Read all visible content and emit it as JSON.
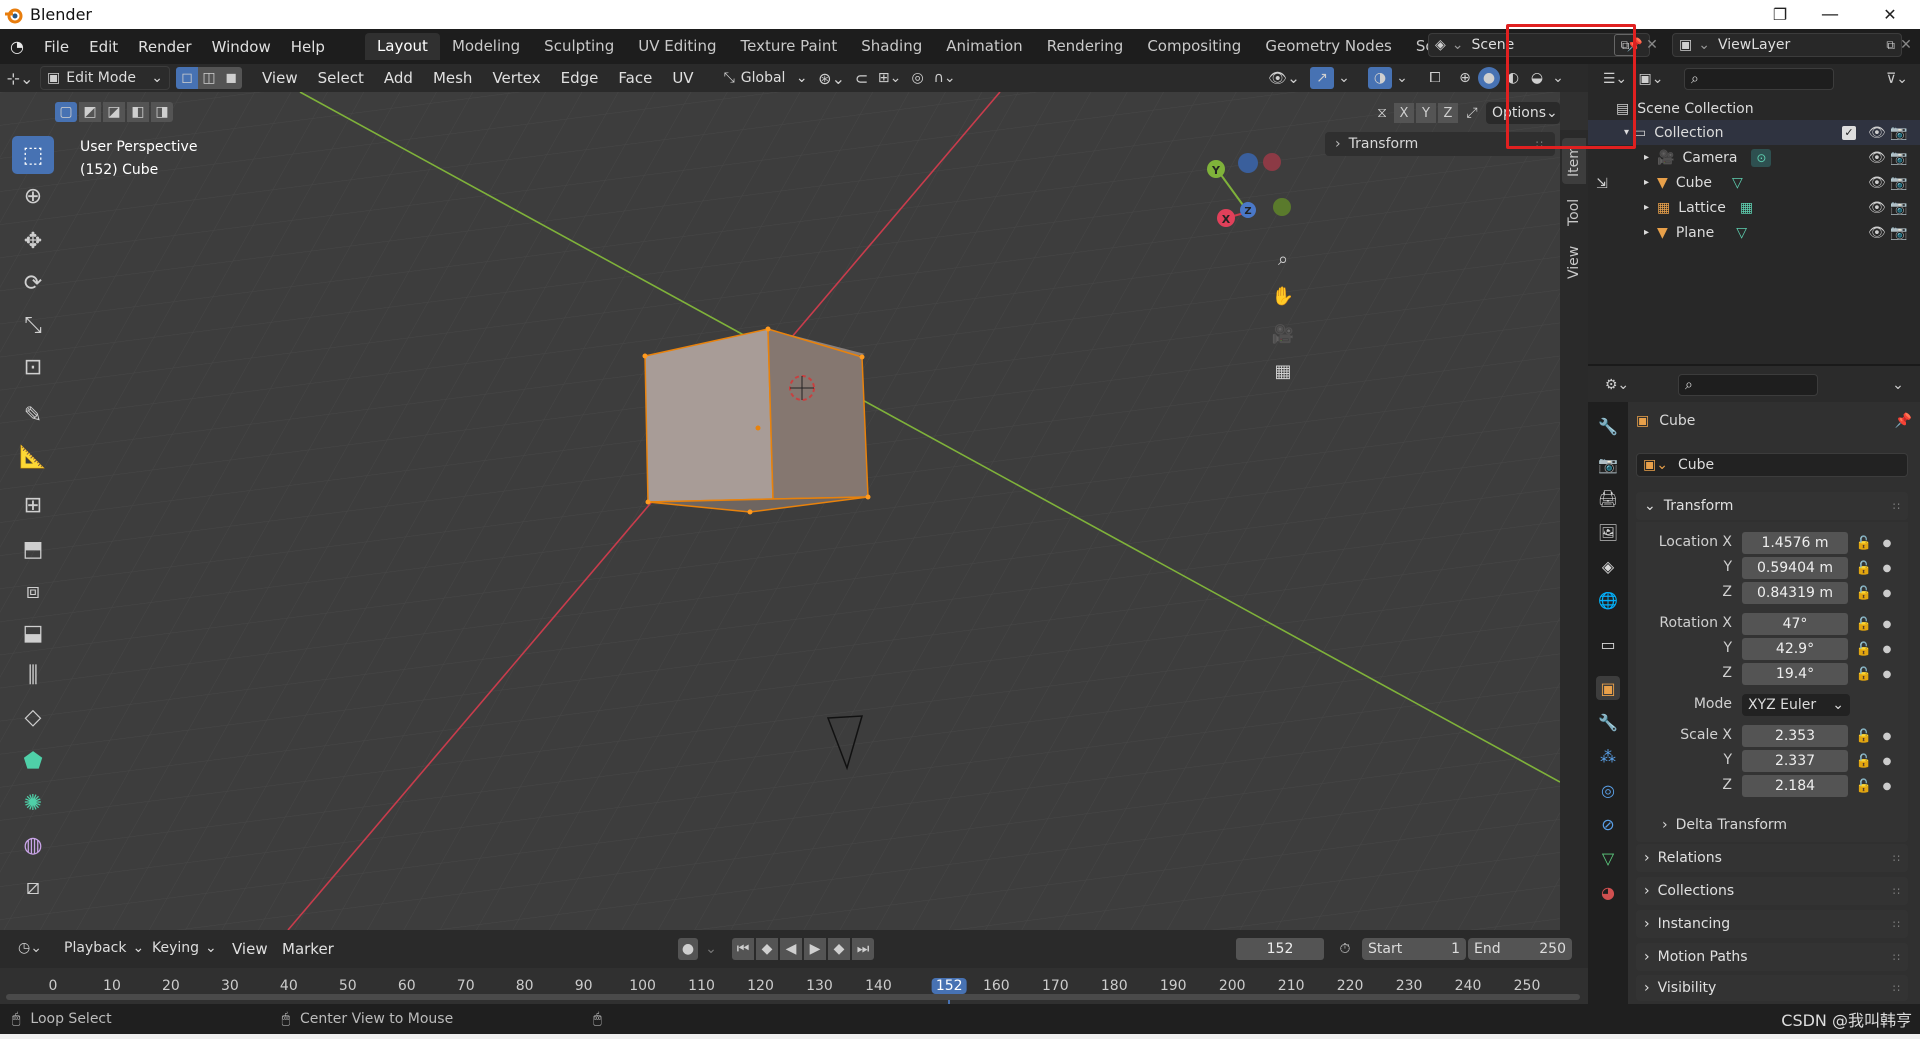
{
  "window": {
    "title": "Blender",
    "minimize": "—",
    "maximize": "❐",
    "close": "✕"
  },
  "menubar": [
    "File",
    "Edit",
    "Render",
    "Window",
    "Help"
  ],
  "workspaces": [
    "Layout",
    "Modeling",
    "Sculpting",
    "UV Editing",
    "Texture Paint",
    "Shading",
    "Animation",
    "Rendering",
    "Compositing",
    "Geometry Nodes",
    "Scripting"
  ],
  "active_workspace": "Layout",
  "scene": {
    "name": "Scene"
  },
  "view_layer": {
    "name": "ViewLayer"
  },
  "viewport_header": {
    "mode": "Edit Mode",
    "menus": [
      "View",
      "Select",
      "Add",
      "Mesh",
      "Vertex",
      "Edge",
      "Face",
      "UV"
    ],
    "orientation": "Global",
    "axes": [
      "X",
      "Y",
      "Z"
    ],
    "options": "Options"
  },
  "viewport": {
    "perspective_label": "User Perspective",
    "object_label": "(152) Cube",
    "npanel_section": "Transform",
    "npanel_tabs": [
      "Item",
      "Tool",
      "View"
    ],
    "gizmo_axes": {
      "x": "X",
      "y": "Y",
      "z": "Z"
    },
    "grid_color": "#3d3d3d",
    "x_axis_color": "#c83c4c",
    "y_axis_color": "#7fb23a",
    "selection_color": "#e8820c",
    "highlight_box_color": "#e02020"
  },
  "outliner": {
    "root": "Scene Collection",
    "collection": "Collection",
    "items": [
      {
        "name": "Camera",
        "icon": "camera-icon"
      },
      {
        "name": "Cube",
        "icon": "mesh-icon"
      },
      {
        "name": "Lattice",
        "icon": "lattice-icon"
      },
      {
        "name": "Plane",
        "icon": "mesh-icon"
      }
    ]
  },
  "properties": {
    "object_name": "Cube",
    "data_name": "Cube",
    "transform_title": "Transform",
    "location_label": "Location X",
    "location": [
      "1.4576 m",
      "0.59404 m",
      "0.84319 m"
    ],
    "rotation_label": "Rotation X",
    "rotation": [
      "47°",
      "42.9°",
      "19.4°"
    ],
    "mode_label": "Mode",
    "rotation_mode": "XYZ Euler",
    "scale_label": "Scale X",
    "scale": [
      "2.353",
      "2.337",
      "2.184"
    ],
    "y_label": "Y",
    "z_label": "Z",
    "subpanels": [
      "Delta Transform",
      "Relations",
      "Collections",
      "Instancing",
      "Motion Paths",
      "Visibility"
    ]
  },
  "timeline": {
    "menus": [
      "Playback",
      "Keying",
      "View",
      "Marker"
    ],
    "current_frame": "152",
    "start_label": "Start",
    "start": "1",
    "end_label": "End",
    "end": "250",
    "ticks": [
      "0",
      "10",
      "20",
      "30",
      "40",
      "50",
      "60",
      "70",
      "80",
      "90",
      "100",
      "110",
      "120",
      "130",
      "140",
      "152",
      "160",
      "170",
      "180",
      "190",
      "200",
      "210",
      "220",
      "230",
      "240",
      "250"
    ]
  },
  "statusbar": {
    "left": "Loop Select",
    "middle": "Center View to Mouse",
    "watermark": "CSDN @我叫韩亨"
  }
}
